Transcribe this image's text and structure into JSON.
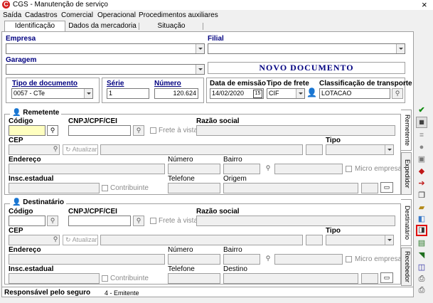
{
  "window": {
    "title": "CGS - Manutenção de serviço",
    "close": "×"
  },
  "menu": [
    "Saída",
    "Cadastros",
    "Comercial",
    "Operacional",
    "Procedimentos auxiliares"
  ],
  "tabs": [
    "Identificação",
    "Dados da mercadoria",
    "Situação"
  ],
  "empresa": {
    "label": "Empresa",
    "value": ""
  },
  "filial": {
    "label": "Filial",
    "value": ""
  },
  "garagem": {
    "label": "Garagem",
    "value": ""
  },
  "novo_doc": "NOVO DOCUMENTO",
  "doc": {
    "tipo_label": "Tipo de documento",
    "tipo_value": "0057 - CTe",
    "serie_label": "Série",
    "serie_value": "1",
    "numero_label": "Número",
    "numero_value": "120.624",
    "emissao_label": "Data de emissão",
    "emissao_value": "14/02/2020",
    "frete_label": "Tipo de frete",
    "frete_value": "CIF",
    "class_label": "Classificação de transporte",
    "class_value": "LOTACAO"
  },
  "remetente": {
    "title": "Remetente",
    "codigo": "Código",
    "cnpj": "CNPJ/CPF/CEI",
    "frete_vista": "Frete à vista",
    "razao": "Razão social",
    "cep": "CEP",
    "atualizar": "Atualizar",
    "tipo": "Tipo",
    "endereco": "Endereço",
    "numero": "Número",
    "bairro": "Bairro",
    "micro": "Micro empresa",
    "insc": "Insc.estadual",
    "contribuinte": "Contribuinte",
    "telefone": "Telefone",
    "origem": "Origem"
  },
  "destinatario": {
    "title": "Destinatário",
    "codigo": "Código",
    "cnpj": "CNPJ/CPF/CEI",
    "frete_vista": "Frete à vista",
    "razao": "Razão social",
    "cep": "CEP",
    "atualizar": "Atualizar",
    "tipo": "Tipo",
    "endereco": "Endereço",
    "numero": "Número",
    "bairro": "Bairro",
    "micro": "Micro empresa",
    "insc": "Insc.estadual",
    "contribuinte": "Contribuinte",
    "telefone": "Telefone",
    "destino": "Destino"
  },
  "side_tabs": [
    "Remetente",
    "Expedidor",
    "Destinatário",
    "Recebedor"
  ],
  "footer": {
    "label": "Responsável pelo seguro",
    "value": "4 - Emitente"
  },
  "icons": {
    "check": "✔",
    "binoculars": "⚲"
  }
}
